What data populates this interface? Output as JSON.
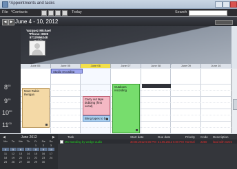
{
  "window": {
    "title": "*Appointments and tasks"
  },
  "toolbar": {
    "file_label": "File",
    "contacts_label": "*Contacts",
    "today_label": "Today",
    "search_label": "Search"
  },
  "datebar": {
    "range": "June 4 - 10, 2012"
  },
  "resource": {
    "line1": "Vazquez Michael",
    "line2": "*Phone: 8039 8712/956248",
    "line3": "Mobile"
  },
  "days": [
    "June 05",
    "June 05",
    "June 06",
    "June 07",
    "June 08",
    "June 09",
    "June 10"
  ],
  "today_index": 2,
  "hours": [
    {
      "h": "8",
      "m": "00"
    },
    {
      "h": "9",
      "m": "00"
    },
    {
      "h": "10",
      "m": "00"
    },
    {
      "h": "11",
      "m": "00"
    }
  ],
  "appointments": [
    {
      "text": "Studio recording",
      "color": "#9ea6ee"
    },
    {
      "text": "Meet Rubin Rerigan",
      "color": "#f4d9a6"
    },
    {
      "text": "Carry out tape dubbing (first vocal)",
      "color": "#f4b8c4"
    },
    {
      "text": "Bring tapes to bar",
      "color": "#a9d0f2"
    },
    {
      "text": "Outdoors recording",
      "color": "#77dd6d"
    }
  ],
  "minical": {
    "month": "June 2012",
    "dow": [
      "Mo",
      "Tu",
      "We",
      "Th",
      "Fr",
      "Sa",
      "Su"
    ],
    "weeks": [
      [
        "",
        "",
        "",
        "",
        "1",
        "2",
        "3"
      ],
      [
        "4",
        "5",
        "6",
        "7",
        "8",
        "9",
        "10"
      ],
      [
        "11",
        "12",
        "13",
        "14",
        "15",
        "16",
        "17"
      ],
      [
        "18",
        "19",
        "20",
        "21",
        "22",
        "23",
        "24"
      ],
      [
        "25",
        "26",
        "27",
        "28",
        "29",
        "30",
        ""
      ]
    ]
  },
  "tasks": {
    "headers": [
      "Task",
      "Start date",
      "Due date",
      "Priority",
      "Code",
      "Description"
    ],
    "rows": [
      {
        "task": "MO standing by wedge audio",
        "start": "30.05.2012 5:00 PM",
        "due": "31.05.2012 5:00 PM",
        "priority": "Normal",
        "code": "2260",
        "description": "load with notes"
      }
    ]
  },
  "colors": {
    "today_header": "#f3e04a",
    "dark_panel": "#2f3137",
    "task_text_green": "#22cc22",
    "task_text_red": "#e03030"
  }
}
